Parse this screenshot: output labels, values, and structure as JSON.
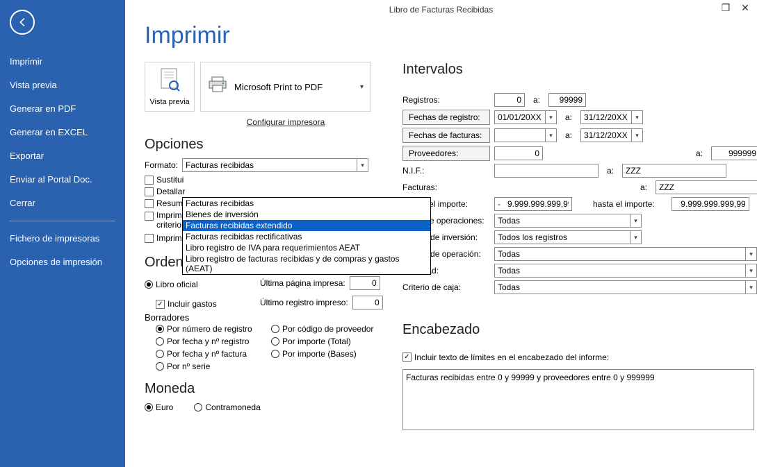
{
  "titlebar": {
    "title": "Libro de Facturas Recibidas"
  },
  "sidebar": {
    "items": [
      "Imprimir",
      "Vista previa",
      "Generar en PDF",
      "Generar en EXCEL",
      "Exportar",
      "Enviar al Portal Doc.",
      "Cerrar"
    ],
    "items2": [
      "Fichero de impresoras",
      "Opciones de impresión"
    ]
  },
  "page_heading": "Imprimir",
  "cards": {
    "preview_label": "Vista previa",
    "printer_name": "Microsoft Print to PDF",
    "configure_link": "Configurar impresora"
  },
  "sections": {
    "opciones": "Opciones",
    "ordenacion": "Ordenación",
    "moneda": "Moneda",
    "intervalos": "Intervalos",
    "encabezado": "Encabezado"
  },
  "opciones": {
    "formato_label": "Formato:",
    "formato_selected": "Facturas recibidas",
    "dropdown": [
      "Facturas recibidas",
      "Bienes de inversión",
      "Facturas recibidas extendido",
      "Facturas recibidas rectificativas",
      "Libro registro de IVA para requerimientos AEAT",
      "Libro registro de facturas recibidas y de compras y gastos (AEAT)"
    ],
    "dd_selected_index": 2,
    "chk_sustituir": "Sustitui",
    "chk_detallar": "Detallar",
    "chk_resumir": "Resumi",
    "chk_imprimir_criterio": "Imprimir … criterio de caja",
    "chk_orden_inverso": "Imprimir en orden inverso"
  },
  "ordenacion": {
    "r_libro": "Libro oficial",
    "chk_incluir_gastos": "Incluir gastos",
    "borradores": "Borradores",
    "ultima_pagina_lbl": "Última página impresa:",
    "ultima_pagina_val": "0",
    "ultimo_registro_lbl": "Último registro impreso:",
    "ultimo_registro_val": "0",
    "r_num_reg": "Por número de registro",
    "r_cod_prov": "Por código de proveedor",
    "r_fecha_reg": "Por fecha y nº registro",
    "r_imp_total": "Por importe (Total)",
    "r_fecha_fact": "Por fecha y nº factura",
    "r_imp_bases": "Por importe (Bases)",
    "r_serie": "Por nº serie"
  },
  "moneda": {
    "r_euro": "Euro",
    "r_contra": "Contramoneda"
  },
  "intervalos": {
    "registros": "Registros:",
    "reg_from": "0",
    "reg_to": "99999",
    "a": "a:",
    "fechas_registro_btn": "Fechas de registro:",
    "fechas_facturas_btn": "Fechas de facturas:",
    "date_from_reg": "01/01/20XX",
    "date_to_reg": "31/12/20XX",
    "date_from_fact": "",
    "date_to_fact": "31/12/20XX",
    "proveedores_btn": "Proveedores:",
    "prov_from": "0",
    "prov_to": "999999",
    "nif": "N.I.F.:",
    "nif_from": "",
    "nif_to": "ZZZ",
    "facturas": "Facturas:",
    "fact_to": "ZZZ",
    "desde_importe": "Desde el importe:",
    "desde_val": "-   9.999.999.999,99",
    "hasta_importe": "hasta el importe:",
    "hasta_val": "9.999.999.999,99",
    "tipos_op": "Tipos de operaciones:",
    "tipos_val": "Todas",
    "bienes_inv": "Bienes de inversión:",
    "bienes_val": "Todos los registros",
    "claves": "Claves de operación:",
    "claves_val": "Todas",
    "actividad": "Actividad:",
    "actividad_val": "Todas",
    "criterio": "Criterio de caja:",
    "criterio_val": "Todas"
  },
  "encabezado": {
    "chk": "Incluir texto de límites en el encabezado del informe:",
    "text": "Facturas recibidas entre 0 y 99999 y proveedores entre 0 y 999999"
  }
}
